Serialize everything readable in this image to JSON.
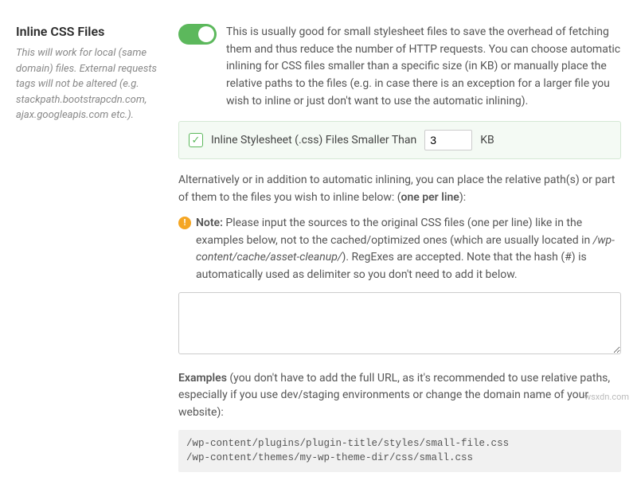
{
  "sidebar": {
    "title": "Inline CSS Files",
    "subtitle": "This will work for local (same domain) files. External requests tags will not be altered (e.g. stackpath.bootstrapcdn.com, ajax.googleapis.com etc.)."
  },
  "main": {
    "description": "This is usually good for small stylesheet files to save the overhead of fetching them and thus reduce the number of HTTP requests. You can choose automatic inlining for CSS files smaller than a specific size (in KB) or manually place the relative paths to the files (e.g. in case there is an exception for a larger file you wish to inline or just don't want to use the automatic inlining).",
    "inline_box": {
      "label": "Inline Stylesheet (.css) Files Smaller Than",
      "value": "3",
      "unit": "KB"
    },
    "alt_text1": "Alternatively or in addition to automatic inlining, you can place the relative path(s) or part of them to the files you wish to inline below: (",
    "alt_bold": "one per line",
    "alt_text2": "):",
    "note_label": "Note:",
    "note_text1": " Please input the sources to the original CSS files (one per line) like in the examples below, not to the cached/optimized ones (which are usually located in ",
    "note_em": "/wp-content/cache/asset-cleanup/",
    "note_text2": "). RegExes are accepted. Note that the hash (#) is automatically used as delimiter so you don't need to add it below.",
    "textarea_value": "",
    "examples_label": "Examples",
    "examples_text": " (you don't have to add the full URL, as it's recommended to use relative paths, especially if you use dev/staging environments or change the domain name of your website):",
    "examples_code": "/wp-content/plugins/plugin-title/styles/small-file.css\n/wp-content/themes/my-wp-theme-dir/css/small.css"
  },
  "watermark": "wsxdn.com"
}
